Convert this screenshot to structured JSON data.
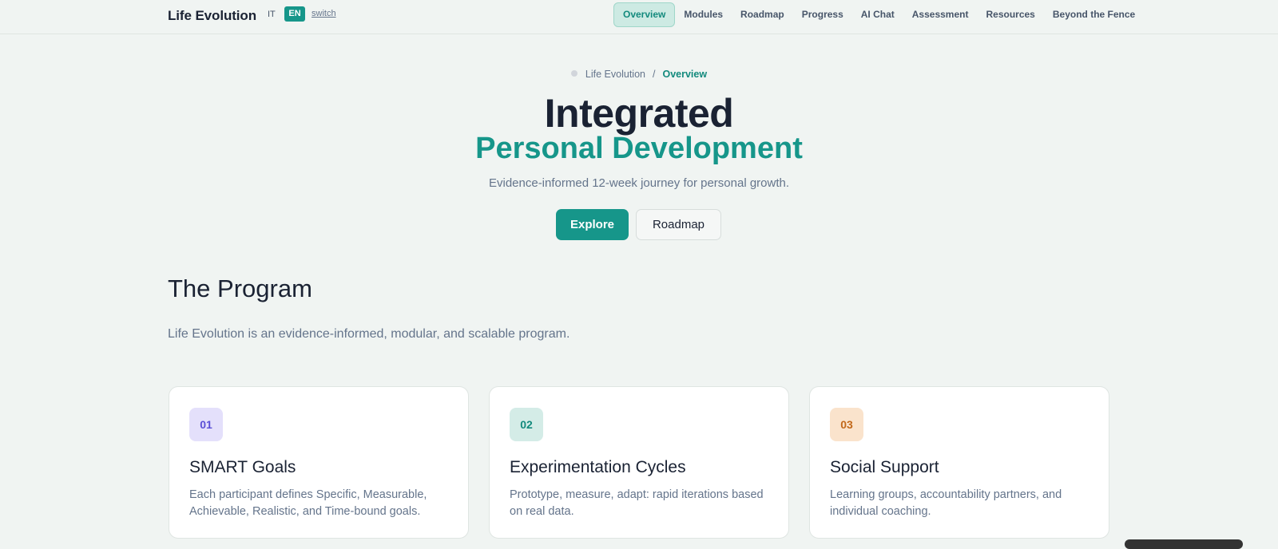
{
  "header": {
    "brand": "Life Evolution",
    "lang_it": "IT",
    "lang_en": "EN",
    "switch_label": "switch",
    "nav": [
      "Overview",
      "Modules",
      "Roadmap",
      "Progress",
      "AI Chat",
      "Assessment",
      "Resources",
      "Beyond the Fence"
    ],
    "active_nav": "Overview"
  },
  "breadcrumb": {
    "root": "Life Evolution",
    "separator": "/",
    "current": "Overview"
  },
  "hero": {
    "title": "Integrated",
    "subtitle": "Personal Development",
    "description": "Evidence-informed 12-week journey for personal growth.",
    "primary_button": "Explore",
    "secondary_button": "Roadmap"
  },
  "program": {
    "title": "The Program",
    "description": "Life Evolution is an evidence-informed, modular, and scalable program.",
    "cards": [
      {
        "number": "01",
        "title": "SMART Goals",
        "text": "Each participant defines Specific, Measurable, Achievable, Realistic, and Time-bound goals.",
        "badge_bg": "#e4e0fb",
        "badge_color": "#5b4fd6"
      },
      {
        "number": "02",
        "title": "Experimentation Cycles",
        "text": "Prototype, measure, adapt: rapid iterations based on real data.",
        "badge_bg": "#d4ece7",
        "badge_color": "#138a7d"
      },
      {
        "number": "03",
        "title": "Social Support",
        "text": "Learning groups, accountability partners, and individual coaching.",
        "badge_bg": "#fae3cc",
        "badge_color": "#c2681a"
      }
    ]
  },
  "colors": {
    "accent": "#16968a",
    "background": "#f0f4f2",
    "text_dark": "#1a2233",
    "text_muted": "#64748b"
  }
}
